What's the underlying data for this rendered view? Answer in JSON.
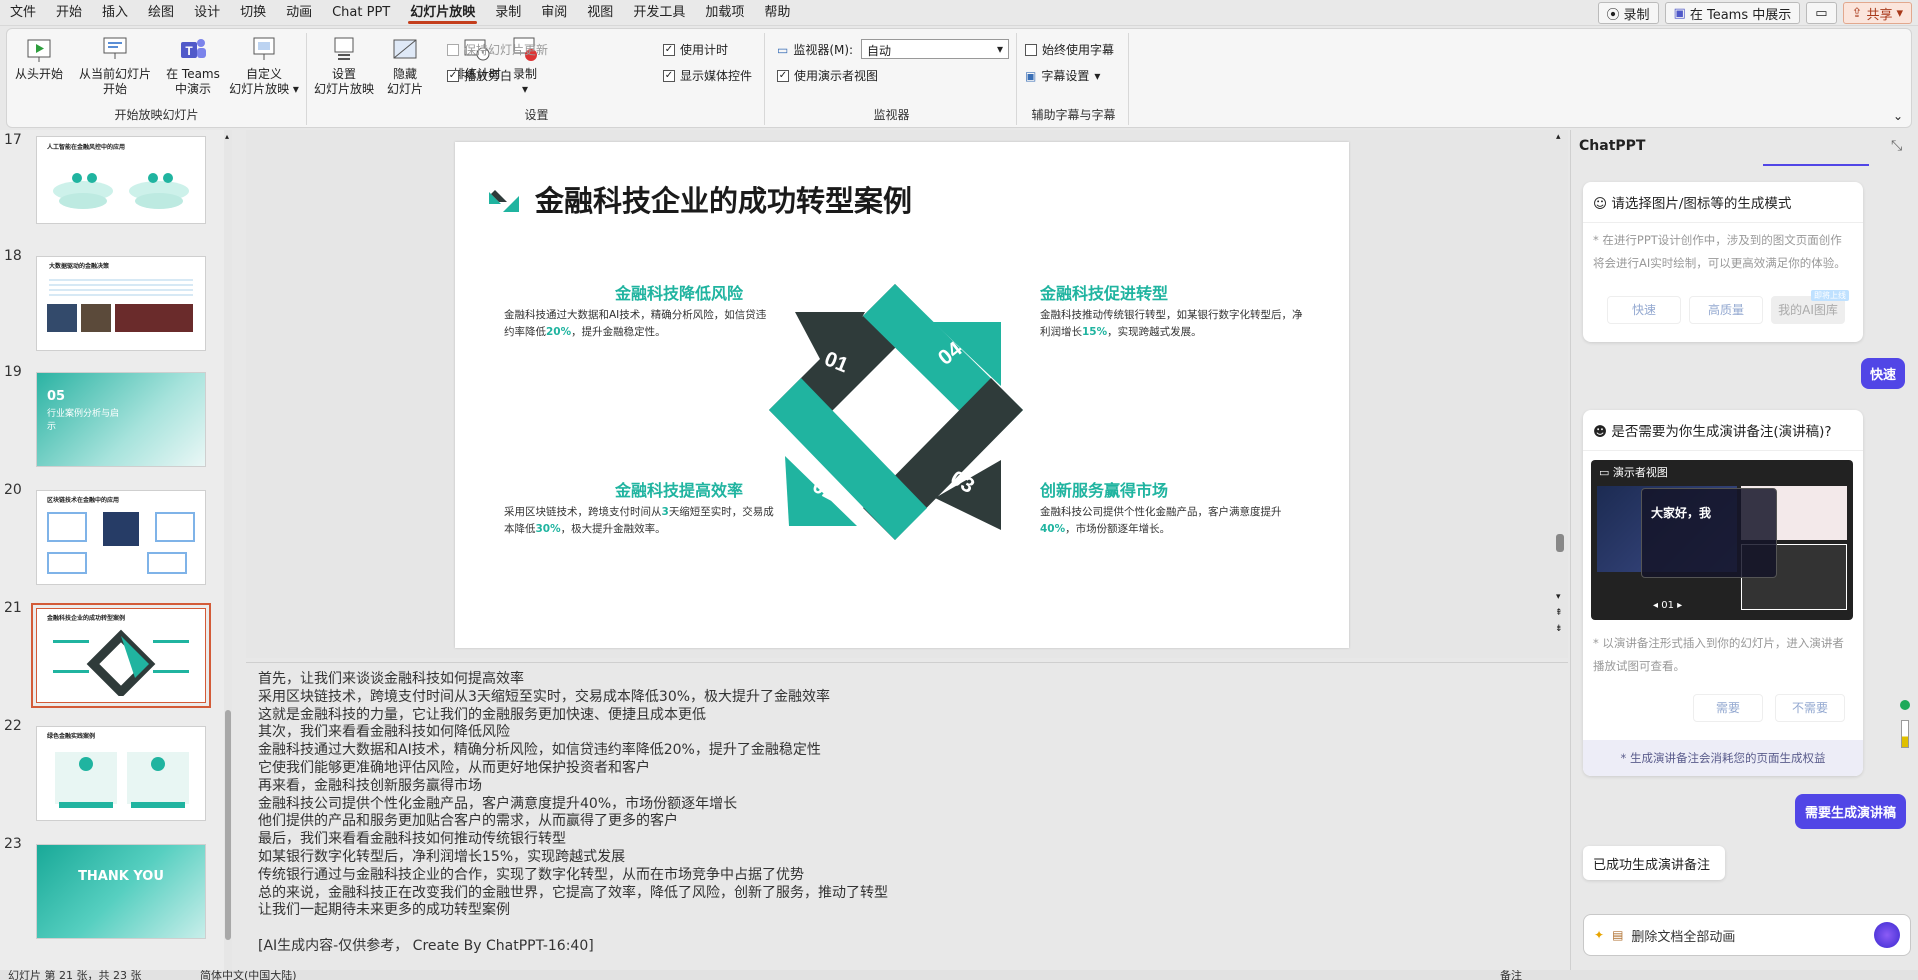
{
  "menubar": {
    "items": [
      "文件",
      "开始",
      "插入",
      "绘图",
      "设计",
      "切换",
      "动画",
      "Chat PPT",
      "幻灯片放映",
      "录制",
      "审阅",
      "视图",
      "开发工具",
      "加载项",
      "帮助"
    ],
    "active_index": 8,
    "record_label": "录制",
    "teams_label": "在 Teams 中展示",
    "share_label": "共享"
  },
  "ribbon": {
    "groups": {
      "start": "开始放映幻灯片",
      "setup": "设置",
      "monitors": "监视器",
      "captions": "辅助字幕与字幕"
    },
    "from_start": "从头开始",
    "from_current_1": "从当前幻灯片",
    "from_current_2": "开始",
    "teams_1": "在 Teams",
    "teams_2": "中演示",
    "custom_1": "自定义",
    "custom_2": "幻灯片放映",
    "setup_show_1": "设置",
    "setup_show_2": "幻灯片放映",
    "hide_1": "隐藏",
    "hide_2": "幻灯片",
    "rehearse": "排练计时",
    "record": "录制",
    "keep_updated": "保持幻灯片更新",
    "play_narration": "播放旁白",
    "use_timings": "使用计时",
    "show_media": "显示媒体控件",
    "monitor_label": "监视器(M):",
    "monitor_value": "自动",
    "presenter_view": "使用演示者视图",
    "always_subtitles": "始终使用字幕",
    "subtitle_settings": "字幕设置"
  },
  "thumbnails": [
    {
      "num": "17",
      "title": "人工智能在金融风控中的应用"
    },
    {
      "num": "18",
      "title": "大数据驱动的金融决策"
    },
    {
      "num": "19",
      "title": "05",
      "subtitle": "行业案例分析与启示"
    },
    {
      "num": "20",
      "title": "区块链技术在金融中的应用"
    },
    {
      "num": "21",
      "title": "金融科技企业的成功转型案例"
    },
    {
      "num": "22",
      "title": "绿色金融实践案例"
    },
    {
      "num": "23",
      "title": "THANK YOU"
    }
  ],
  "selected_thumbnail": 4,
  "slide": {
    "title": "金融科技企业的成功转型案例",
    "q1": {
      "title": "金融科技降低风险",
      "text_a": "金融科技通过大数据和AI技术，精确分析风险，如信贷违约率降低",
      "hl": "20%",
      "text_b": "，提升金融稳定性。"
    },
    "q2": {
      "title": "金融科技提高效率",
      "text_a": "采用区块链技术，跨境支付时间从",
      "hl0": "3",
      "text_mid": "天缩短至实时，交易成本降低",
      "hl": "30%",
      "text_b": "，极大提升金融效率。"
    },
    "q3": {
      "title": "创新服务赢得市场",
      "text_a": "金融科技公司提供个性化金融产品，客户满意度提升",
      "hl": "40%",
      "text_b": "，市场份额逐年增长。"
    },
    "q4": {
      "title": "金融科技促进转型",
      "text_a": "金融科技推动传统银行转型，如某银行数字化转型后，净利润增长",
      "hl": "15%",
      "text_b": "，实现跨越式发展。"
    },
    "num1": "01",
    "num2": "02",
    "num3": "03",
    "num4": "04"
  },
  "notes": [
    "首先，让我们来谈谈金融科技如何提高效率",
    "采用区块链技术，跨境支付时间从3天缩短至实时，交易成本降低30%，极大提升了金融效率",
    "这就是金融科技的力量，它让我们的金融服务更加快速、便捷且成本更低",
    "其次，我们来看看金融科技如何降低风险",
    "金融科技通过大数据和AI技术，精确分析风险，如信贷违约率降低20%，提升了金融稳定性",
    "它使我们能够更准确地评估风险，从而更好地保护投资者和客户",
    "再来看，金融科技创新服务赢得市场",
    "金融科技公司提供个性化金融产品，客户满意度提升40%，市场份额逐年增长",
    "他们提供的产品和服务更加贴合客户的需求，从而赢得了更多的客户",
    "最后，我们来看看金融科技如何推动传统银行转型",
    "如某银行数字化转型后，净利润增长15%，实现跨越式发展",
    "传统银行通过与金融科技企业的合作，实现了数字化转型，从而在市场竞争中占据了优势",
    "总的来说，金融科技正在改变我们的金融世界，它提高了效率，降低了风险，创新了服务，推动了转型",
    "让我们一起期待未来更多的成功转型案例",
    "",
    "[AI生成内容-仅供参考， Create By ChatPPT-16:40]"
  ],
  "chat": {
    "title": "ChatPPT",
    "card1": {
      "header": "请选择图片/图标等的生成模式",
      "desc": "* 在进行PPT设计创作中，涉及到的图文页面创作将会进行AI实时绘制，可以更高效满足你的体验。",
      "opt_fast": "快速",
      "opt_quality": "高质量",
      "opt_mine": "我的AI图库",
      "badge": "即将上线"
    },
    "bubble1": "快速",
    "card2": {
      "header": "是否需要为你生成演讲备注(演讲稿)?",
      "preview_title": "演示者视图",
      "preview_greeting": "大家好，我",
      "preview_page": "01",
      "desc": "* 以演讲备注形式插入到你的幻灯片，进入演讲者播放试图可查看。",
      "opt_yes": "需要",
      "opt_no": "不需要",
      "footer": "* 生成演讲备注会消耗您的页面生成权益"
    },
    "bubble2": "需要生成演讲稿",
    "reply": "已成功生成演讲备注",
    "input_text": "删除文档全部动画"
  },
  "colors": {
    "accent": "#c43e1c",
    "teal": "#20b4a0",
    "dark": "#2f3b3a",
    "chat_accent": "#5146e6"
  },
  "statusbar": {
    "slide_info": "幻灯片 第 21 张，共 23 张",
    "language": "简体中文(中国大陆)",
    "notes": "备注"
  }
}
